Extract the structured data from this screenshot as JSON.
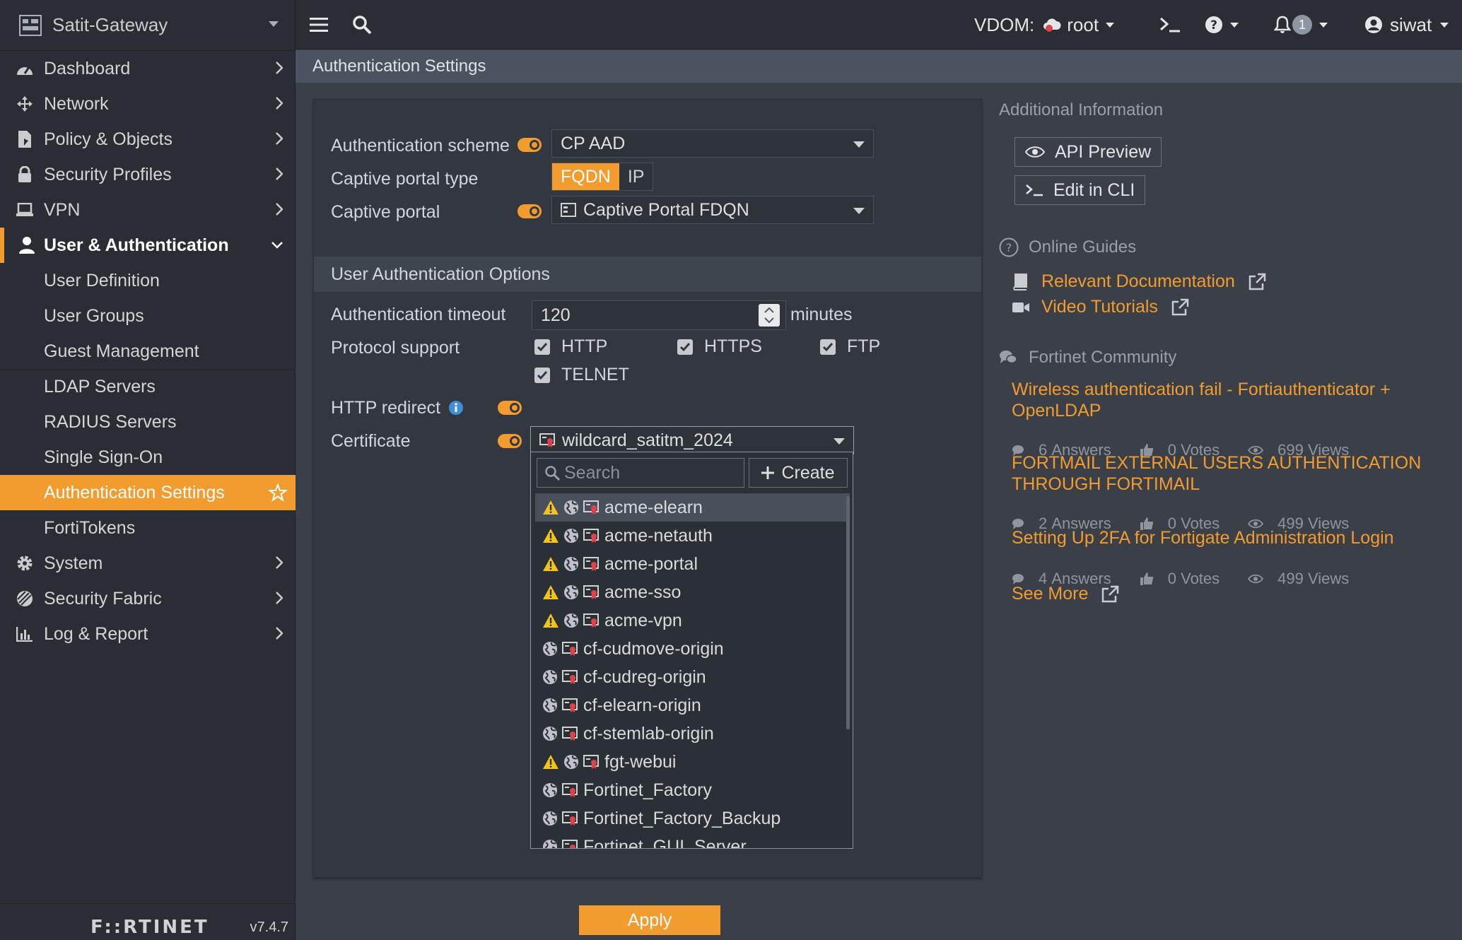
{
  "colors": {
    "accent": "#f29b2f",
    "sidebar_bg": "#2a2e34",
    "content_bg": "#3b4048",
    "panel_bg": "#333840",
    "warning": "#f0c419",
    "cert_red": "#e0424a"
  },
  "sidebar": {
    "device_name": "Satit-Gateway",
    "items": [
      {
        "label": "Dashboard",
        "icon": "dashboard-icon"
      },
      {
        "label": "Network",
        "icon": "network-icon"
      },
      {
        "label": "Policy & Objects",
        "icon": "policy-icon"
      },
      {
        "label": "Security Profiles",
        "icon": "lock-icon"
      },
      {
        "label": "VPN",
        "icon": "laptop-icon"
      },
      {
        "label": "User & Authentication",
        "icon": "user-icon"
      }
    ],
    "subitems": [
      "User Definition",
      "User Groups",
      "Guest Management",
      "LDAP Servers",
      "RADIUS Servers",
      "Single Sign-On",
      "Authentication Settings",
      "FortiTokens"
    ],
    "items_after": [
      {
        "label": "System",
        "icon": "gear-icon"
      },
      {
        "label": "Security Fabric",
        "icon": "fabric-icon"
      },
      {
        "label": "Log & Report",
        "icon": "chart-icon"
      }
    ],
    "brand": "F::RTINET",
    "version": "v7.4.7"
  },
  "topbar": {
    "vdom_label": "VDOM:",
    "vdom_value": "root",
    "notifications_count": "1",
    "username": "siwat"
  },
  "page": {
    "title": "Authentication Settings"
  },
  "form": {
    "auth_scheme_label": "Authentication scheme",
    "auth_scheme_value": "CP AAD",
    "captive_portal_type_label": "Captive portal type",
    "portal_type_options": [
      "FQDN",
      "IP"
    ],
    "portal_type_selected": "FQDN",
    "captive_portal_label": "Captive portal",
    "captive_portal_value": "Captive Portal FDQN",
    "section_title": "User Authentication Options",
    "timeout_label": "Authentication timeout",
    "timeout_value": "120",
    "timeout_unit": "minutes",
    "protocol_label": "Protocol support",
    "protocols": [
      "HTTP",
      "HTTPS",
      "FTP",
      "TELNET"
    ],
    "http_redirect_label": "HTTP redirect",
    "certificate_label": "Certificate",
    "certificate_value": "wildcard_satitm_2024",
    "apply_label": "Apply"
  },
  "dropdown": {
    "search_placeholder": "Search",
    "create_label": "Create",
    "items": [
      {
        "name": "acme-elearn",
        "warning": true
      },
      {
        "name": "acme-netauth",
        "warning": true
      },
      {
        "name": "acme-portal",
        "warning": true
      },
      {
        "name": "acme-sso",
        "warning": true
      },
      {
        "name": "acme-vpn",
        "warning": true
      },
      {
        "name": "cf-cudmove-origin",
        "warning": false
      },
      {
        "name": "cf-cudreg-origin",
        "warning": false
      },
      {
        "name": "cf-elearn-origin",
        "warning": false
      },
      {
        "name": "cf-stemlab-origin",
        "warning": false
      },
      {
        "name": "fgt-webui",
        "warning": true
      },
      {
        "name": "Fortinet_Factory",
        "warning": false
      },
      {
        "name": "Fortinet_Factory_Backup",
        "warning": false
      },
      {
        "name": "Fortinet_GUI_Server",
        "warning": false
      }
    ]
  },
  "info": {
    "heading": "Additional Information",
    "api_preview": "API Preview",
    "edit_cli": "Edit in CLI",
    "guides_heading": "Online Guides",
    "relevant_docs": "Relevant Documentation",
    "video_tutorials": "Video Tutorials",
    "community_heading": "Fortinet Community",
    "posts": [
      {
        "title": "Wireless authentication fail - Fortiauthenticator + OpenLDAP",
        "answers": "6",
        "votes": "0",
        "views": "699"
      },
      {
        "title": "FORTMAIL EXTERNAL USERS AUTHENTICATION THROUGH FORTIMAIL",
        "answers": "2",
        "votes": "0",
        "views": "499"
      },
      {
        "title": "Setting Up 2FA for Fortigate Administration Login",
        "answers": "4",
        "votes": "0",
        "views": "499"
      }
    ],
    "answers_label": "Answers",
    "votes_label": "Votes",
    "views_label": "Views",
    "see_more": "See More"
  }
}
